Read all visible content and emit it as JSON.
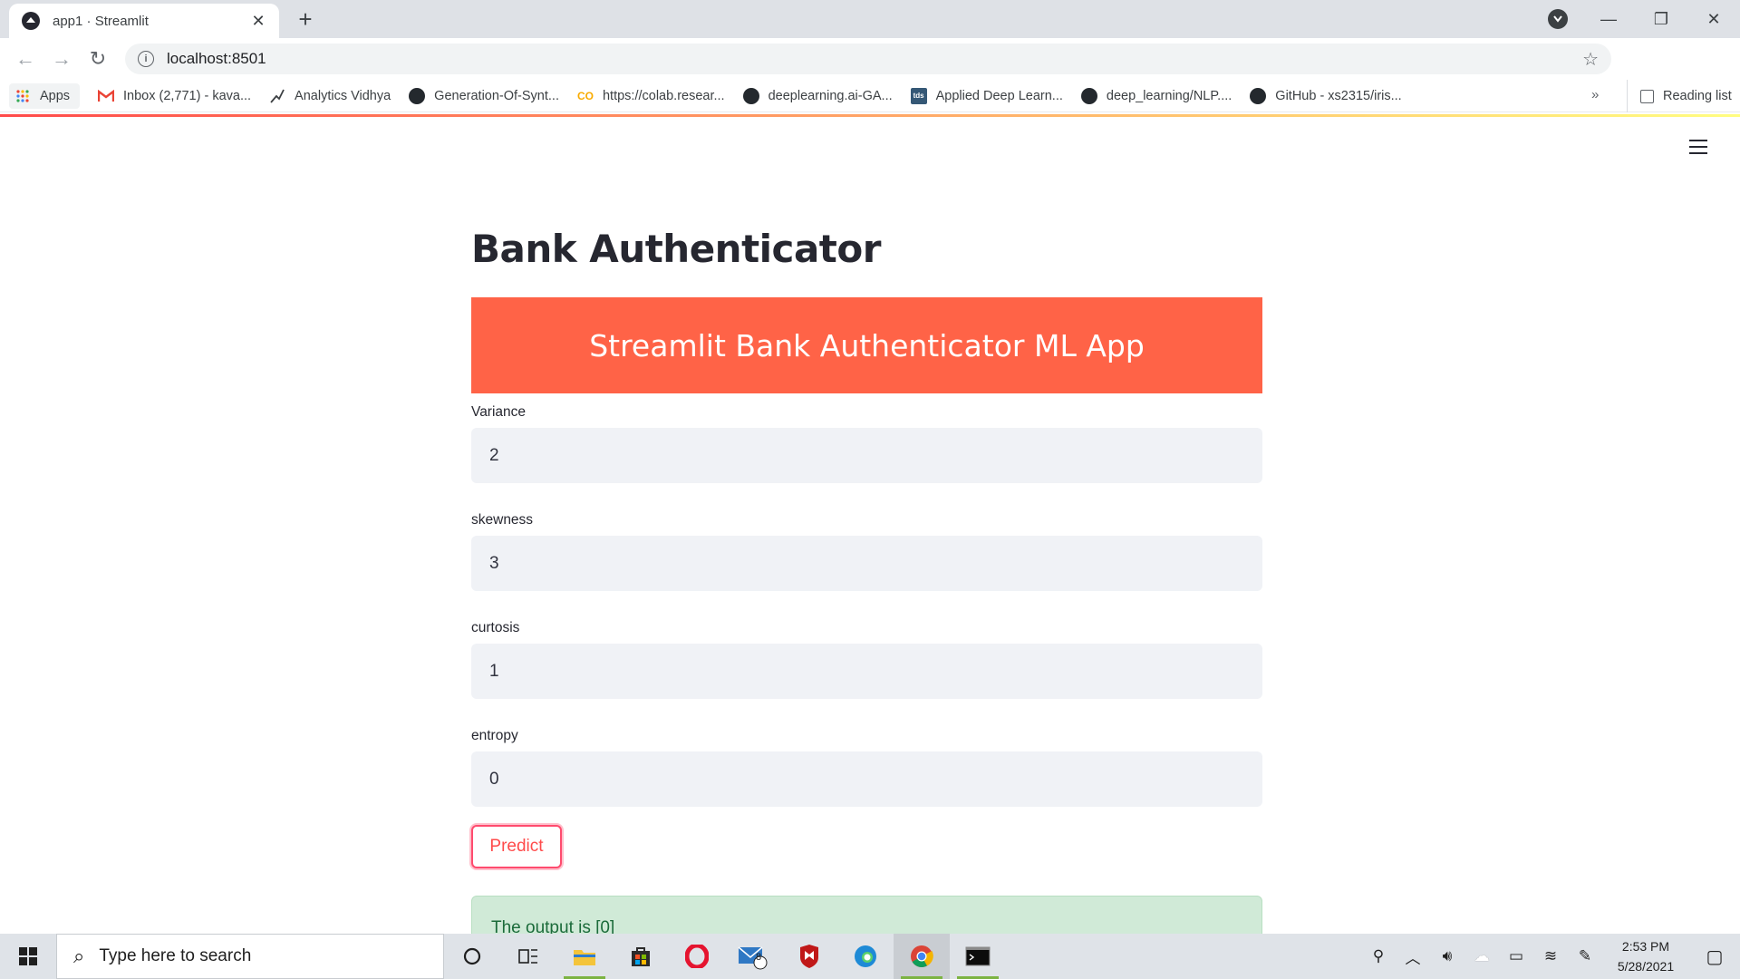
{
  "browser": {
    "tab_title": "app1 · Streamlit",
    "tab_close": "✕",
    "new_tab": "+",
    "url": "localhost:8501",
    "window_controls": [
      "—",
      "❐",
      "✕"
    ],
    "bookmarks": [
      {
        "label": "Apps",
        "icon": "apps-grid-icon"
      },
      {
        "label": "Inbox (2,771) - kava...",
        "icon": "gmail-icon"
      },
      {
        "label": "Analytics Vidhya",
        "icon": "analytics-vidhya-icon"
      },
      {
        "label": "Generation-Of-Synt...",
        "icon": "github-icon"
      },
      {
        "label": "https://colab.resear...",
        "icon": "colab-icon"
      },
      {
        "label": "deeplearning.ai-GA...",
        "icon": "github-icon"
      },
      {
        "label": "Applied Deep Learn...",
        "icon": "tds-icon"
      },
      {
        "label": "deep_learning/NLP....",
        "icon": "github-icon"
      },
      {
        "label": "GitHub - xs2315/iris...",
        "icon": "github-icon"
      }
    ],
    "bookmarks_more": "»",
    "reading_list": "Reading list",
    "tds_badge": "tds",
    "colab_badge": "CO"
  },
  "app": {
    "title": "Bank Authenticator",
    "banner": "Streamlit Bank Authenticator ML App",
    "banner_color": "#ff6347",
    "fields": [
      {
        "label": "Variance",
        "value": "2"
      },
      {
        "label": "skewness",
        "value": "3"
      },
      {
        "label": "curtosis",
        "value": "1"
      },
      {
        "label": "entropy",
        "value": "0"
      }
    ],
    "predict_label": "Predict",
    "output": "The output is [0]"
  },
  "taskbar": {
    "search_placeholder": "Type here to search",
    "mail_badge": "8",
    "time": "2:53 PM",
    "date": "5/28/2021"
  }
}
